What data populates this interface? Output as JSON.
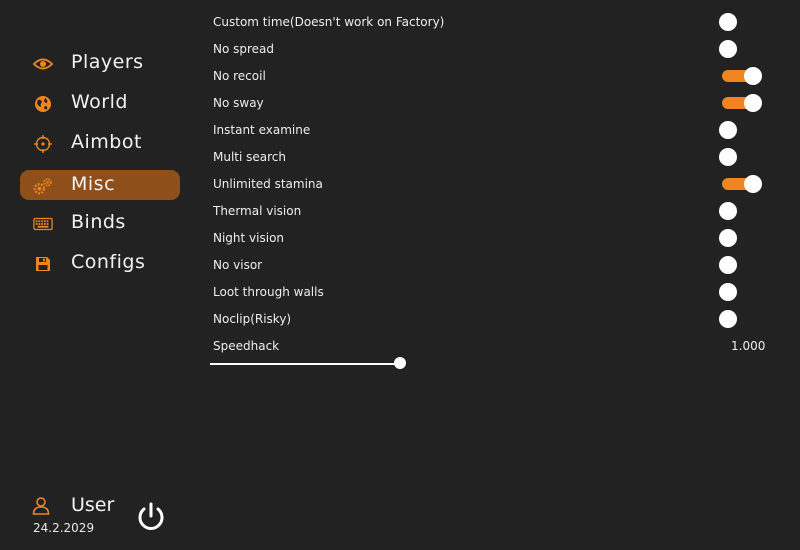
{
  "sidebar": {
    "items": [
      {
        "label": "Players",
        "icon": "eye-icon",
        "active": false
      },
      {
        "label": "World",
        "icon": "globe-icon",
        "active": false
      },
      {
        "label": "Aimbot",
        "icon": "crosshair-icon",
        "active": false
      },
      {
        "label": "Misc",
        "icon": "gears-icon",
        "active": true
      },
      {
        "label": "Binds",
        "icon": "keyboard-icon",
        "active": false
      },
      {
        "label": "Configs",
        "icon": "floppy-disk-icon",
        "active": false
      }
    ]
  },
  "user": {
    "name": "User",
    "date": "24.2.2029",
    "icon": "user-icon",
    "power_icon": "power-icon"
  },
  "options": [
    {
      "label": "Custom time(Doesn't work on Factory)",
      "enabled": false
    },
    {
      "label": "No spread",
      "enabled": false
    },
    {
      "label": "No recoil",
      "enabled": true
    },
    {
      "label": "No sway",
      "enabled": true
    },
    {
      "label": "Instant examine",
      "enabled": false
    },
    {
      "label": "Multi search",
      "enabled": false
    },
    {
      "label": "Unlimited stamina",
      "enabled": true
    },
    {
      "label": "Thermal vision",
      "enabled": false
    },
    {
      "label": "Night vision",
      "enabled": false
    },
    {
      "label": "No visor",
      "enabled": false
    },
    {
      "label": "Loot through walls",
      "enabled": false
    },
    {
      "label": "Noclip(Risky)",
      "enabled": false
    }
  ],
  "speedhack": {
    "label": "Speedhack",
    "value": "1.000"
  },
  "colors": {
    "accent": "#f08520",
    "active_nav": "#8e4f1a",
    "background": "#222222"
  }
}
